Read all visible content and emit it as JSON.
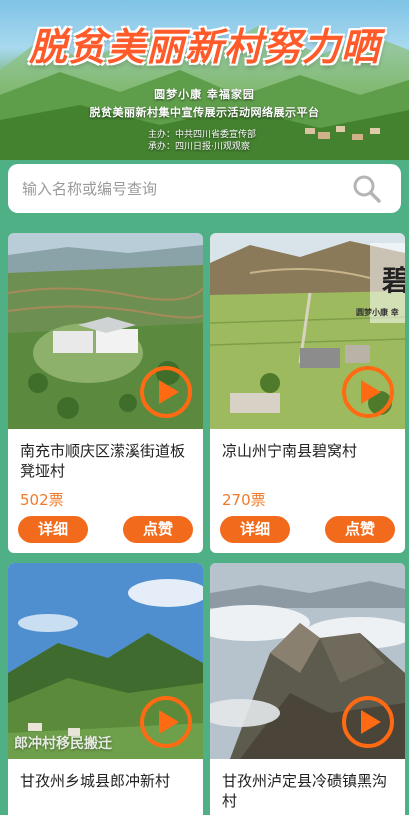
{
  "banner": {
    "title": "脱贫美丽新村努力晒",
    "subtitle_1": "圆梦小康 幸福家园",
    "subtitle_2": "脱贫美丽新村集中宣传展示活动网络展示平台",
    "host": "主办：中共四川省委宣传部",
    "organizer": "承办：四川日报·川观观察"
  },
  "search": {
    "placeholder": "输入名称或编号查询",
    "icon": "search-icon"
  },
  "cards": [
    {
      "title": "南充市顺庆区潆溪街道板凳垭村",
      "votes": "502票",
      "detail_label": "详细",
      "like_label": "点赞"
    },
    {
      "title": "凉山州宁南县碧窝村",
      "votes": "270票",
      "detail_label": "详细",
      "like_label": "点赞",
      "overlay": "碧",
      "overlay_small": "圆梦小康 幸"
    },
    {
      "title": "甘孜州乡城县郎冲新村",
      "overlay": "郎冲村移民搬迁"
    },
    {
      "title": "甘孜州泸定县冷碛镇黑沟村"
    }
  ],
  "colors": {
    "accent": "#f26a1b",
    "vote": "#f07a2a",
    "background": "#4fb086",
    "title": "#ff5a2a"
  }
}
